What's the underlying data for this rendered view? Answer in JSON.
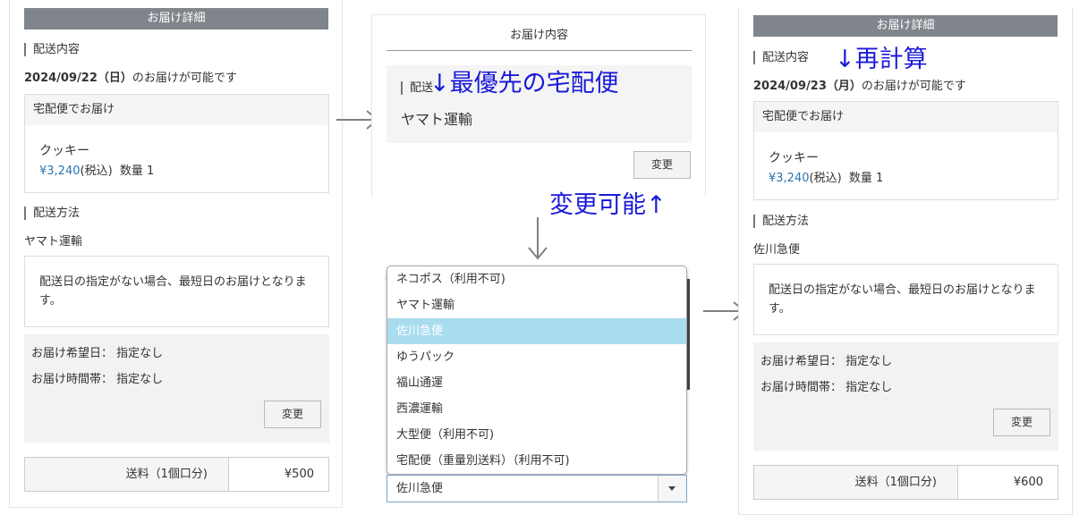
{
  "left": {
    "header": "お届け詳細",
    "delivery_section": "配送内容",
    "date_bold": "2024/09/22（日）",
    "date_suffix": "のお届けが可能です",
    "item_box_title": "宅配便でお届け",
    "product_name": "クッキー",
    "price": "¥3,240",
    "tax": "(税込)",
    "qty": "数量 1",
    "method_section": "配送方法",
    "carrier": "ヤマト運輸",
    "note": "配送日の指定がない場合、最短日のお届けとなります。",
    "pref_date": "お届け希望日： 指定なし",
    "pref_time": "お届け時間帯： 指定なし",
    "change_button": "変更",
    "shipping_label": "送料（1個口分)",
    "shipping_value": "¥500"
  },
  "middle": {
    "card_title": "お届け内容",
    "section_label": "配送",
    "carrier": "ヤマト運輸",
    "change_button": "変更",
    "options": [
      "ネコポス（利用不可)",
      "ヤマト運輸",
      "佐川急便",
      "ゆうパック",
      "福山通運",
      "西濃運輸",
      "大型便（利用不可)",
      "宅配便（重量別送料）（利用不可)"
    ],
    "selected_index": 2,
    "select_value": "佐川急便"
  },
  "right": {
    "header": "お届け詳細",
    "delivery_section": "配送内容",
    "date_bold": "2024/09/23（月）",
    "date_suffix": "のお届けが可能です",
    "item_box_title": "宅配便でお届け",
    "product_name": "クッキー",
    "price": "¥3,240",
    "tax": "(税込)",
    "qty": "数量 1",
    "method_section": "配送方法",
    "carrier": "佐川急便",
    "note": "配送日の指定がない場合、最短日のお届けとなります。",
    "pref_date": "お届け希望日： 指定なし",
    "pref_time": "お届け時間帯： 指定なし",
    "change_button": "変更",
    "shipping_label": "送料（1個口分)",
    "shipping_value": "¥600"
  },
  "annotations": {
    "priority": "↓最優先の宅配便",
    "changeable": "変更可能↑",
    "recalc": "↓再計算",
    "down_arrow": "↓"
  },
  "colors": {
    "header_bar": "#7f858b",
    "annotation": "#1a1ad8",
    "price": "#2b74b3",
    "selected_option": "#aadcf0"
  }
}
